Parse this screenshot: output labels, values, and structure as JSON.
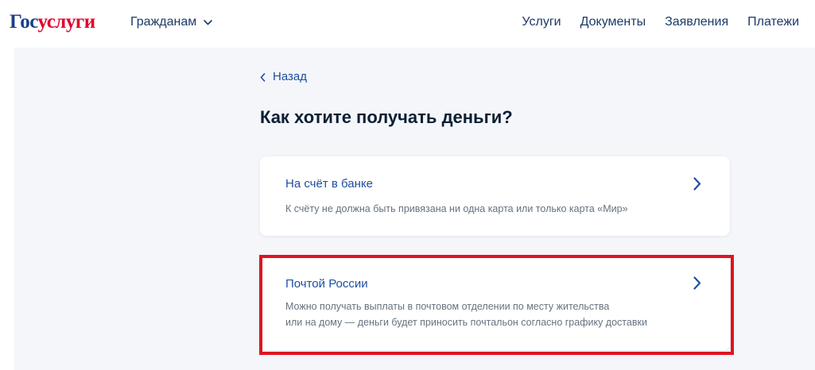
{
  "header": {
    "logo_part1": "Гос",
    "logo_part2": "услуги",
    "citizens_menu": "Гражданам",
    "nav": [
      "Услуги",
      "Документы",
      "Заявления",
      "Платежи"
    ]
  },
  "main": {
    "back_label": "Назад",
    "title": "Как хотите получать деньги?",
    "options": [
      {
        "title": "На счёт в банке",
        "description": "К счёту не должна быть привязана ни одна карта или только карта «Мир»"
      },
      {
        "title": "Почтой России",
        "description_line1": "Можно получать выплаты в почтовом отделении по месту жительства",
        "description_line2": "или на дому — деньги будет приносить почтальон согласно графику доставки"
      }
    ]
  },
  "colors": {
    "link_blue": "#1f4ea1",
    "logo_red": "#e4002b",
    "highlight_red": "#e0141e",
    "page_bg": "#f4f6fa"
  },
  "icons": [
    "chevron-down-icon",
    "chevron-left-icon",
    "chevron-right-icon"
  ]
}
